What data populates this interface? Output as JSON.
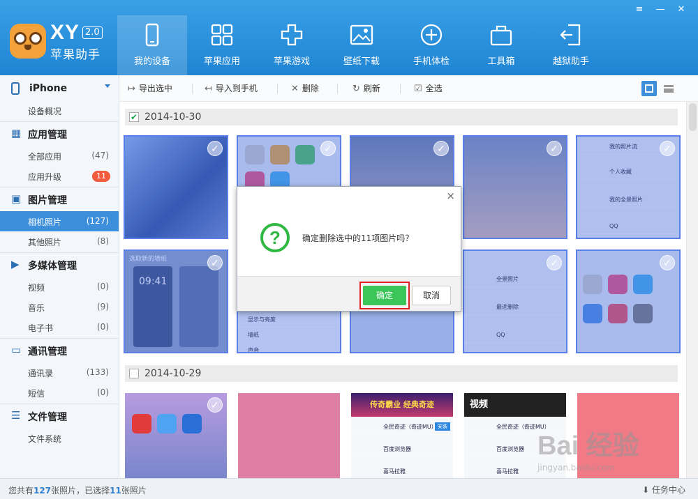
{
  "app": {
    "brand": "XY",
    "version": "2.0",
    "brand_sub": "苹果助手"
  },
  "nav": [
    {
      "label": "我的设备",
      "icon": "device-icon",
      "active": true
    },
    {
      "label": "苹果应用",
      "icon": "apps-grid-icon"
    },
    {
      "label": "苹果游戏",
      "icon": "gamepad-icon"
    },
    {
      "label": "壁纸下载",
      "icon": "wallpaper-icon"
    },
    {
      "label": "手机体检",
      "icon": "checkup-icon"
    },
    {
      "label": "工具箱",
      "icon": "toolbox-icon"
    },
    {
      "label": "越狱助手",
      "icon": "jailbreak-icon"
    }
  ],
  "window_buttons": {
    "menu": "≡",
    "minimize": "—",
    "close": "✕"
  },
  "sidebar": {
    "device": "iPhone",
    "overview": "设备概况",
    "groups": [
      {
        "label": "应用管理",
        "items": [
          {
            "label": "全部应用",
            "count": "(47)"
          },
          {
            "label": "应用升级",
            "badge": "11"
          }
        ]
      },
      {
        "label": "图片管理",
        "items": [
          {
            "label": "相机照片",
            "count": "(127)",
            "active": true
          },
          {
            "label": "其他照片",
            "count": "(8)"
          }
        ]
      },
      {
        "label": "多媒体管理",
        "items": [
          {
            "label": "视频",
            "count": "(0)"
          },
          {
            "label": "音乐",
            "count": "(9)"
          },
          {
            "label": "电子书",
            "count": "(0)"
          }
        ]
      },
      {
        "label": "通讯管理",
        "items": [
          {
            "label": "通讯录",
            "count": "(133)"
          },
          {
            "label": "短信",
            "count": "(0)"
          }
        ]
      },
      {
        "label": "文件管理",
        "items": [
          {
            "label": "文件系统"
          }
        ]
      }
    ]
  },
  "toolbar": {
    "export": "导出选中",
    "import": "导入到手机",
    "delete": "删除",
    "refresh": "刷新",
    "select_all": "全选"
  },
  "sections": [
    {
      "date": "2014-10-30",
      "checked": true
    },
    {
      "date": "2014-10-29",
      "checked": false
    }
  ],
  "thumbs": {
    "caption_wallpaper": "选取新的墙纸",
    "album_rows": [
      "我的照片流",
      "个人收藏",
      "我的全景照片",
      "QQ"
    ],
    "album_rows2": [
      "全景照片",
      "最近删除",
      "QQ"
    ],
    "settings_rows": [
      "显示与亮度",
      "墙纸",
      "声音"
    ],
    "game_banner": "传奇霸业 经典奇迹",
    "list_rows": [
      "全民奇迹（奇迹MU）",
      "百度浏览器",
      "喜马拉雅"
    ],
    "install": "安装",
    "video_title": "视频",
    "lock_time": "09:41"
  },
  "dialog": {
    "message": "确定删除选中的11项图片吗？",
    "ok": "确定",
    "cancel": "取消",
    "close": "×"
  },
  "status": {
    "prefix": "您共有",
    "total": "127",
    "mid": "张照片，已选择",
    "selected": "11",
    "suffix": "张照片",
    "task_center": "任务中心"
  },
  "watermark": {
    "text": "Bai 经验",
    "url": "jingyan.baidu.com"
  }
}
